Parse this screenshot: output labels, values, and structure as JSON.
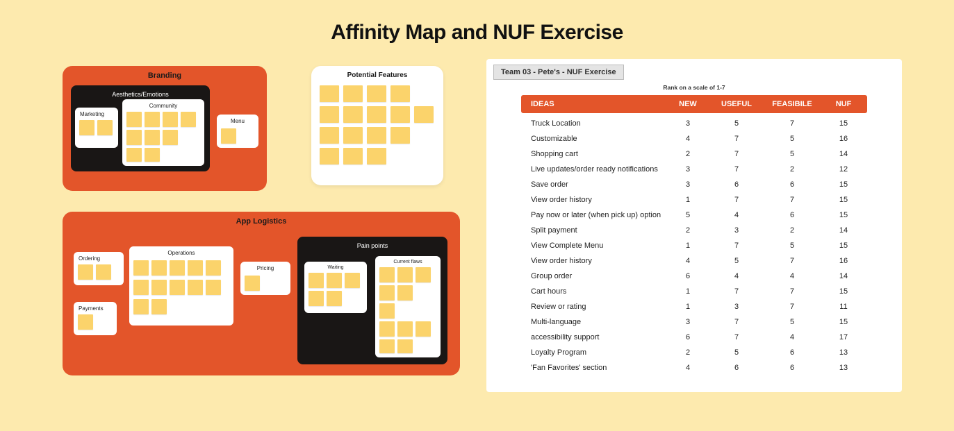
{
  "title": "Affinity Map and NUF Exercise",
  "branding": {
    "title": "Branding",
    "aesthetics": "Aesthetics/Emotions",
    "community": "Community",
    "marketing": "Marketing",
    "menu": "Menu"
  },
  "potential": {
    "title": "Potential Features"
  },
  "logistics": {
    "title": "App Logistics",
    "ordering": "Ordering",
    "operations": "Operations",
    "pricing": "Pricing",
    "payments": "Payments",
    "painpoints": "Pain points",
    "waiting": "Waiting",
    "currentflaws": "Current flaws"
  },
  "nuf": {
    "tag": "Team 03 - Pete's - NUF Exercise",
    "scale": "Rank on a scale of 1-7",
    "cols": {
      "ideas": "IDEAS",
      "new": "NEW",
      "useful": "USEFUL",
      "feasible": "FEASIBILE",
      "nuf": "NUF"
    },
    "rows": [
      {
        "idea": "Truck Location",
        "n": 3,
        "u": 5,
        "f": 7,
        "nuf": 15
      },
      {
        "idea": "Customizable",
        "n": 4,
        "u": 7,
        "f": 5,
        "nuf": 16
      },
      {
        "idea": "Shopping cart",
        "n": 2,
        "u": 7,
        "f": 5,
        "nuf": 14
      },
      {
        "idea": "Live updates/order ready notifications",
        "n": 3,
        "u": 7,
        "f": 2,
        "nuf": 12
      },
      {
        "idea": "Save order",
        "n": 3,
        "u": 6,
        "f": 6,
        "nuf": 15
      },
      {
        "idea": "View order history",
        "n": 1,
        "u": 7,
        "f": 7,
        "nuf": 15
      },
      {
        "idea": "Pay now or later (when pick up) option",
        "n": 5,
        "u": 4,
        "f": 6,
        "nuf": 15
      },
      {
        "idea": "Split payment",
        "n": 2,
        "u": 3,
        "f": 2,
        "nuf": 14
      },
      {
        "idea": "View Complete Menu",
        "n": 1,
        "u": 7,
        "f": 5,
        "nuf": 15
      },
      {
        "idea": "View order history",
        "n": 4,
        "u": 5,
        "f": 7,
        "nuf": 16
      },
      {
        "idea": "Group order",
        "n": 6,
        "u": 4,
        "f": 4,
        "nuf": 14
      },
      {
        "idea": "Cart hours",
        "n": 1,
        "u": 7,
        "f": 7,
        "nuf": 15
      },
      {
        "idea": "Review or rating",
        "n": 1,
        "u": 3,
        "f": 7,
        "nuf": 11
      },
      {
        "idea": "Multi-language",
        "n": 3,
        "u": 7,
        "f": 5,
        "nuf": 15
      },
      {
        "idea": "accessibility support",
        "n": 6,
        "u": 7,
        "f": 4,
        "nuf": 17
      },
      {
        "idea": "Loyalty Program",
        "n": 2,
        "u": 5,
        "f": 6,
        "nuf": 13
      },
      {
        "idea": "'Fan Favorites' section",
        "n": 4,
        "u": 6,
        "f": 6,
        "nuf": 13
      }
    ]
  }
}
